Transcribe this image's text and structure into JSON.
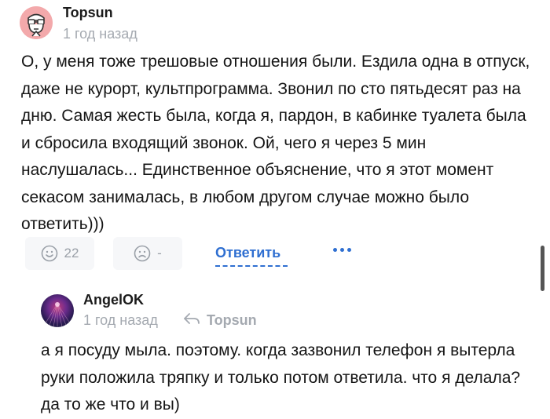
{
  "comment": {
    "author": "Topsun",
    "time": "1 год назад",
    "text": "О, у меня тоже трешовые отношения были. Ездила одна в отпуск, даже не курорт, культпрограмма. Звонил по сто пятьдесят раз на дню. Самая жесть была, когда я, пардон, в кабинке туалета была и сбросила входящий звонок. Ой, чего я через 5 мин наслушалась... Единственное объяснение, что я этот момент секасом занималась, в любом другом случае можно было ответить)))",
    "likes": "22",
    "dislikes": "-",
    "reply_label": "Ответить"
  },
  "reply": {
    "author": "AngelOK",
    "time": "1 год назад",
    "reply_to": "Topsun",
    "text": "а я посуду мыла. поэтому. когда зазвонил телефон я вытерла руки положила тряпку и только потом ответила. что я делала? да то же что и вы)"
  },
  "icons": {
    "like": "smile-icon",
    "dislike": "sad-icon",
    "more": "more-dots-icon",
    "reply_arrow": "reply-arrow-icon"
  },
  "colors": {
    "accent": "#2f6fd1",
    "muted": "#a4a9b0",
    "pill_bg": "#f6f7f9"
  }
}
